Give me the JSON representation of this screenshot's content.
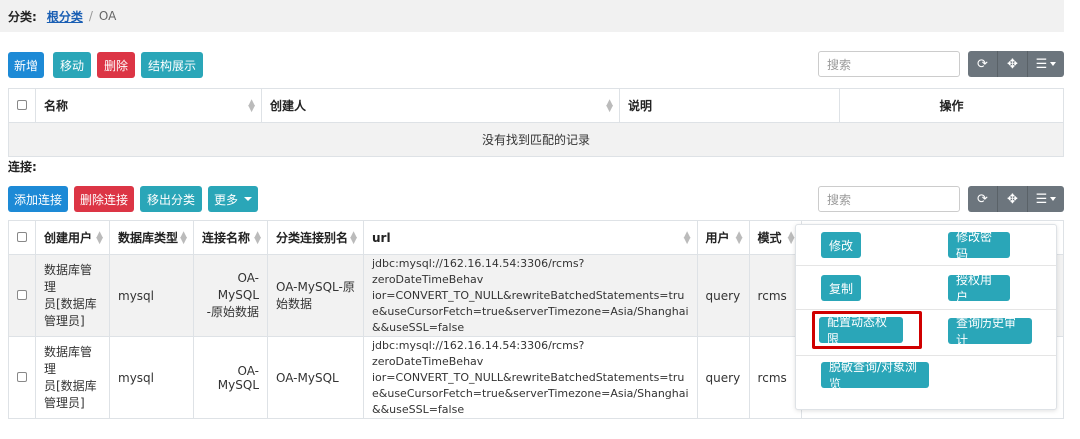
{
  "breadcrumb": {
    "label": "分类:",
    "root": "根分类",
    "separator": "/",
    "current": "OA"
  },
  "category_toolbar": {
    "new": "新增",
    "move": "移动",
    "delete": "删除",
    "structure": "结构展示"
  },
  "search": {
    "placeholder": "搜索"
  },
  "category_table": {
    "headers": {
      "name": "名称",
      "creator": "创建人",
      "description": "说明",
      "actions": "操作"
    },
    "empty_message": "没有找到匹配的记录"
  },
  "connections": {
    "label": "连接:",
    "toolbar": {
      "add": "添加连接",
      "delete": "删除连接",
      "export_category": "移出分类",
      "more": "更多"
    },
    "headers": {
      "create_user": "创建用户",
      "db_type": "数据库类型",
      "conn_name": "连接名称",
      "alias": "分类连接别名",
      "url": "url",
      "user": "用户",
      "mode": "模式"
    },
    "rows": [
      {
        "create_user": [
          "数据库管理",
          "员[数据库",
          "管理员]"
        ],
        "db_type": "mysql",
        "conn_name": [
          "OA-MySQL",
          "-原始数据"
        ],
        "alias": [
          "OA-MySQL-原",
          "始数据"
        ],
        "url": [
          "jdbc:mysql://162.16.14.54:3306/rcms?zeroDateTimeBehav",
          "ior=CONVERT_TO_NULL&rewriteBatchedStatements=tru",
          "e&useCursorFetch=true&serverTimezone=Asia/Shanghai",
          "&&useSSL=false"
        ],
        "user": "query",
        "mode": "rcms"
      },
      {
        "create_user": [
          "数据库管理",
          "员[数据库",
          "管理员]"
        ],
        "db_type": "mysql",
        "conn_name": [
          "OA-MySQL"
        ],
        "alias": [
          "OA-MySQL"
        ],
        "url": [
          "jdbc:mysql://162.16.14.54:3306/rcms?zeroDateTimeBehav",
          "ior=CONVERT_TO_NULL&rewriteBatchedStatements=tru",
          "e&useCursorFetch=true&serverTimezone=Asia/Shanghai",
          "&&useSSL=false"
        ],
        "user": "query",
        "mode": "rcms"
      }
    ]
  },
  "action_menu": {
    "modify": "修改",
    "change_password": "修改密码",
    "copy": "复制",
    "authorize_user": "授权用户",
    "config_dynamic_permission": "配置动态权限",
    "query_audit": "查询历史审计",
    "desensitize": "脱敏查询/对象浏览"
  },
  "colors": {
    "primary": "#1d8ad6",
    "info": "#2aa6b8",
    "danger": "#dc3545",
    "secondary": "#6c757d",
    "highlight": "#d00000"
  },
  "icons": {
    "refresh": "refresh-icon",
    "move": "move-icon",
    "columns": "list-icon"
  }
}
